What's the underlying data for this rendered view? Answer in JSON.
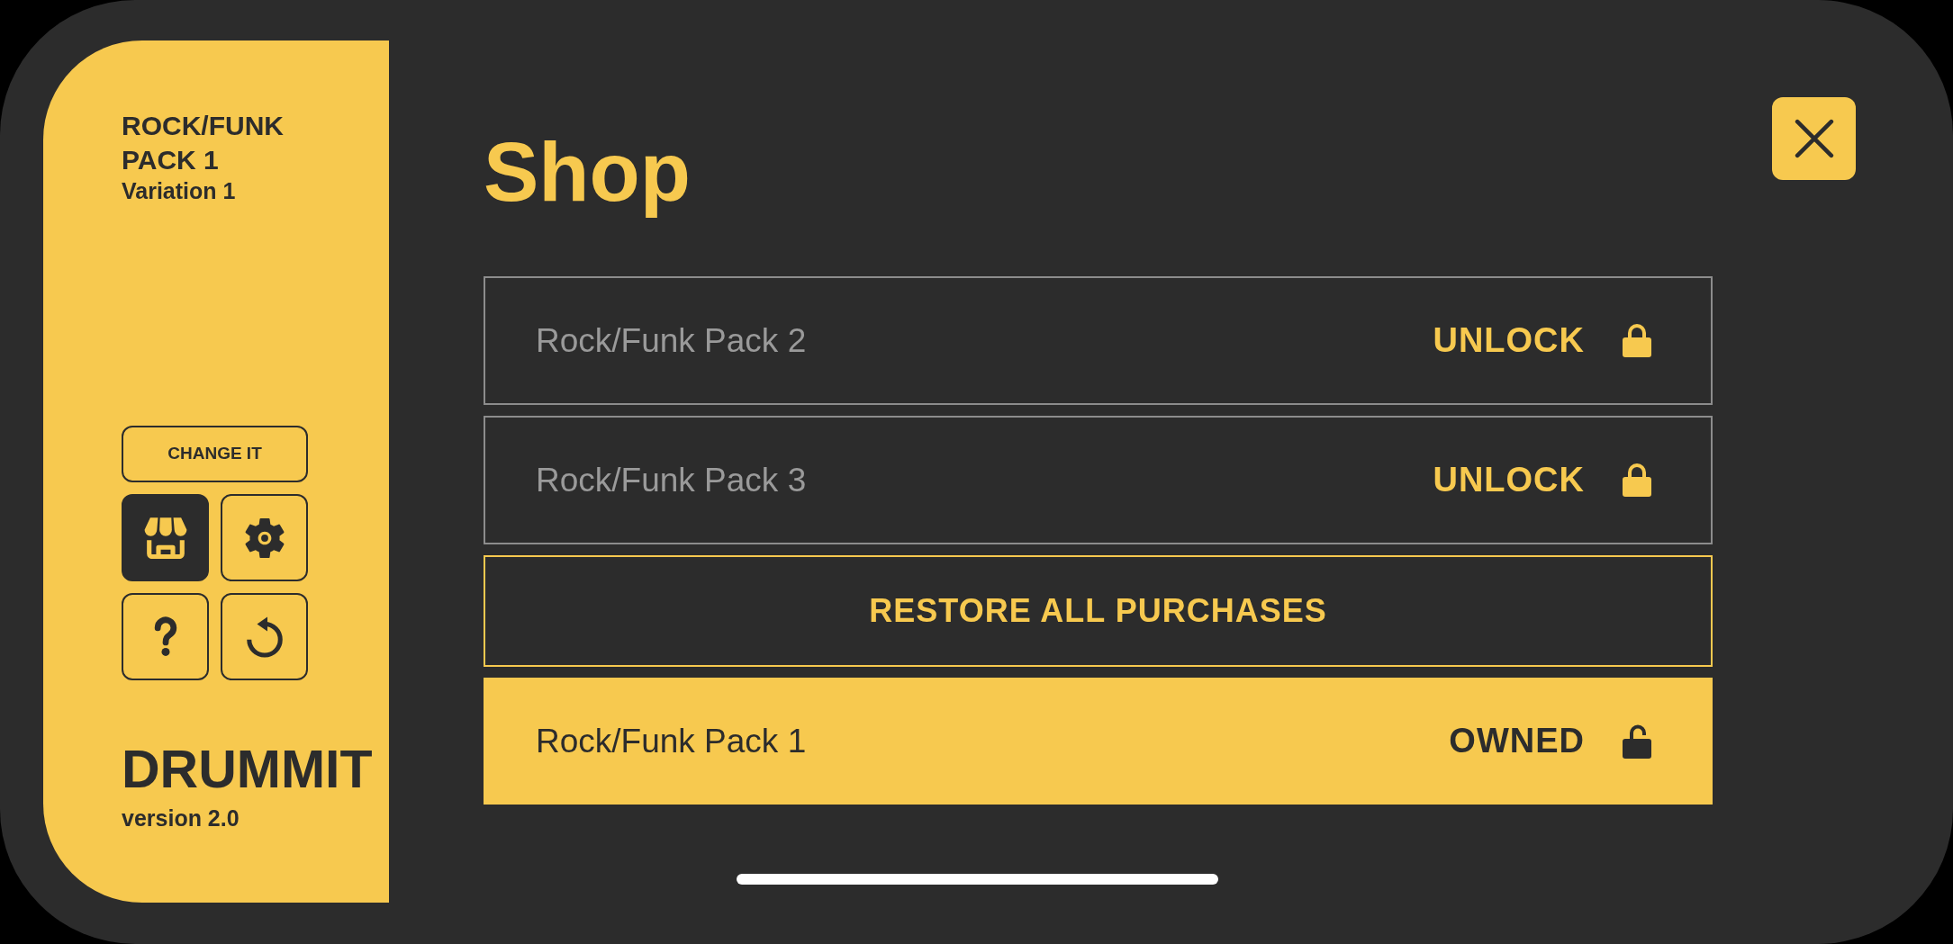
{
  "sidebar": {
    "pack_title": "ROCK/FUNK PACK 1",
    "variation": "Variation 1",
    "change_button": "CHANGE IT",
    "nav_buttons": [
      {
        "kind": "shop",
        "selected": true
      },
      {
        "kind": "settings",
        "selected": false
      },
      {
        "kind": "help",
        "selected": false
      },
      {
        "kind": "rotate",
        "selected": false
      }
    ],
    "app_name": "DRUMMIT",
    "version": "version 2.0"
  },
  "title": "Shop",
  "items": [
    {
      "kind": "pack",
      "name": "Rock/Funk Pack 2",
      "status": "UNLOCK",
      "owned": false
    },
    {
      "kind": "pack",
      "name": "Rock/Funk Pack 3",
      "status": "UNLOCK",
      "owned": false
    },
    {
      "kind": "restore",
      "label": "RESTORE ALL PURCHASES"
    },
    {
      "kind": "pack",
      "name": "Rock/Funk Pack 1",
      "status": "OWNED",
      "owned": true
    }
  ]
}
